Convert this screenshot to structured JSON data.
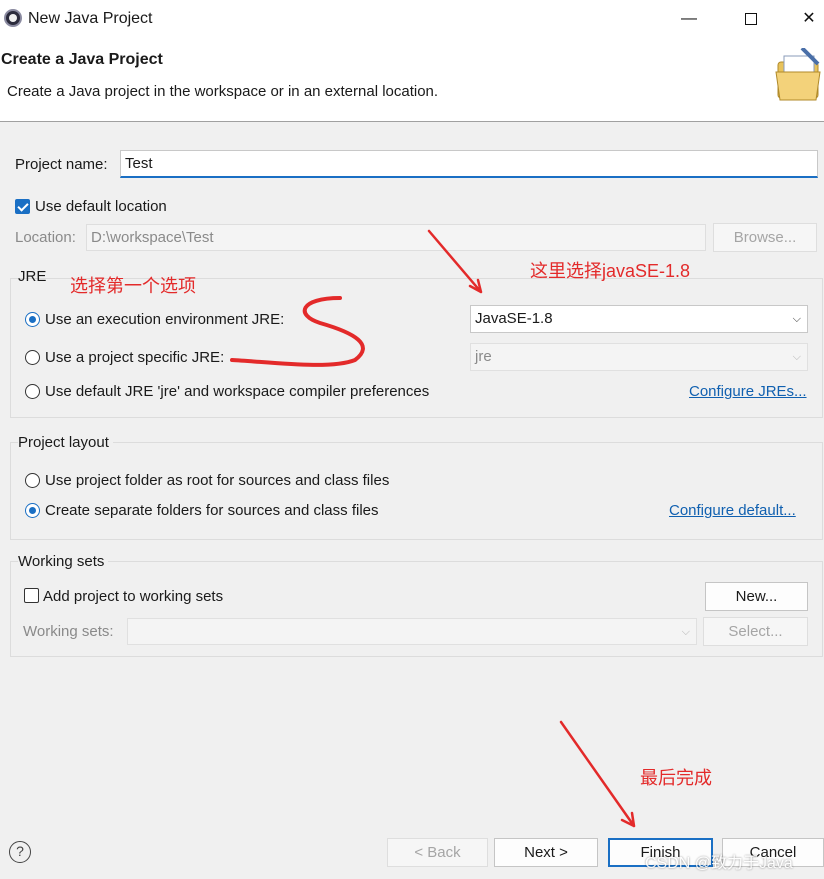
{
  "window": {
    "title": "New Java Project",
    "minimize_glyph": "—",
    "close_glyph": "✕"
  },
  "banner": {
    "title": "Create a Java Project",
    "subtitle": "Create a Java project in the workspace or in an external location.",
    "icon": "new-project-folder-icon"
  },
  "project": {
    "name_label": "Project name:",
    "name_value": "Test",
    "use_default_location_label": "Use default location",
    "use_default_location_checked": true,
    "location_label": "Location:",
    "location_value": "D:\\workspace\\Test",
    "browse_label": "Browse..."
  },
  "jre": {
    "title": "JRE",
    "option_exec_env": "Use an execution environment JRE:",
    "option_project_specific": "Use a project specific JRE:",
    "option_default": "Use default JRE 'jre' and workspace compiler preferences",
    "selected": "exec_env",
    "exec_env_value": "JavaSE-1.8",
    "project_specific_value": "jre",
    "configure_link": "Configure JREs..."
  },
  "layout": {
    "title": "Project layout",
    "option_root": "Use project folder as root for sources and class files",
    "option_separate": "Create separate folders for sources and class files",
    "selected": "separate",
    "configure_link": "Configure default..."
  },
  "working_sets": {
    "title": "Working sets",
    "add_label": "Add project to working sets",
    "add_checked": false,
    "new_button": "New...",
    "sets_label": "Working sets:",
    "select_button": "Select..."
  },
  "footer": {
    "help_glyph": "?",
    "back_button": "< Back",
    "next_button": "Next >",
    "finish_button": "Finish",
    "cancel_button": "Cancel"
  },
  "annotations": {
    "pick_first": "选择第一个选项",
    "pick_javase": "这里选择javaSE-1.8",
    "finish_note": "最后完成",
    "color": "#e32a2a"
  },
  "watermark": "CSDN @致力于Java"
}
